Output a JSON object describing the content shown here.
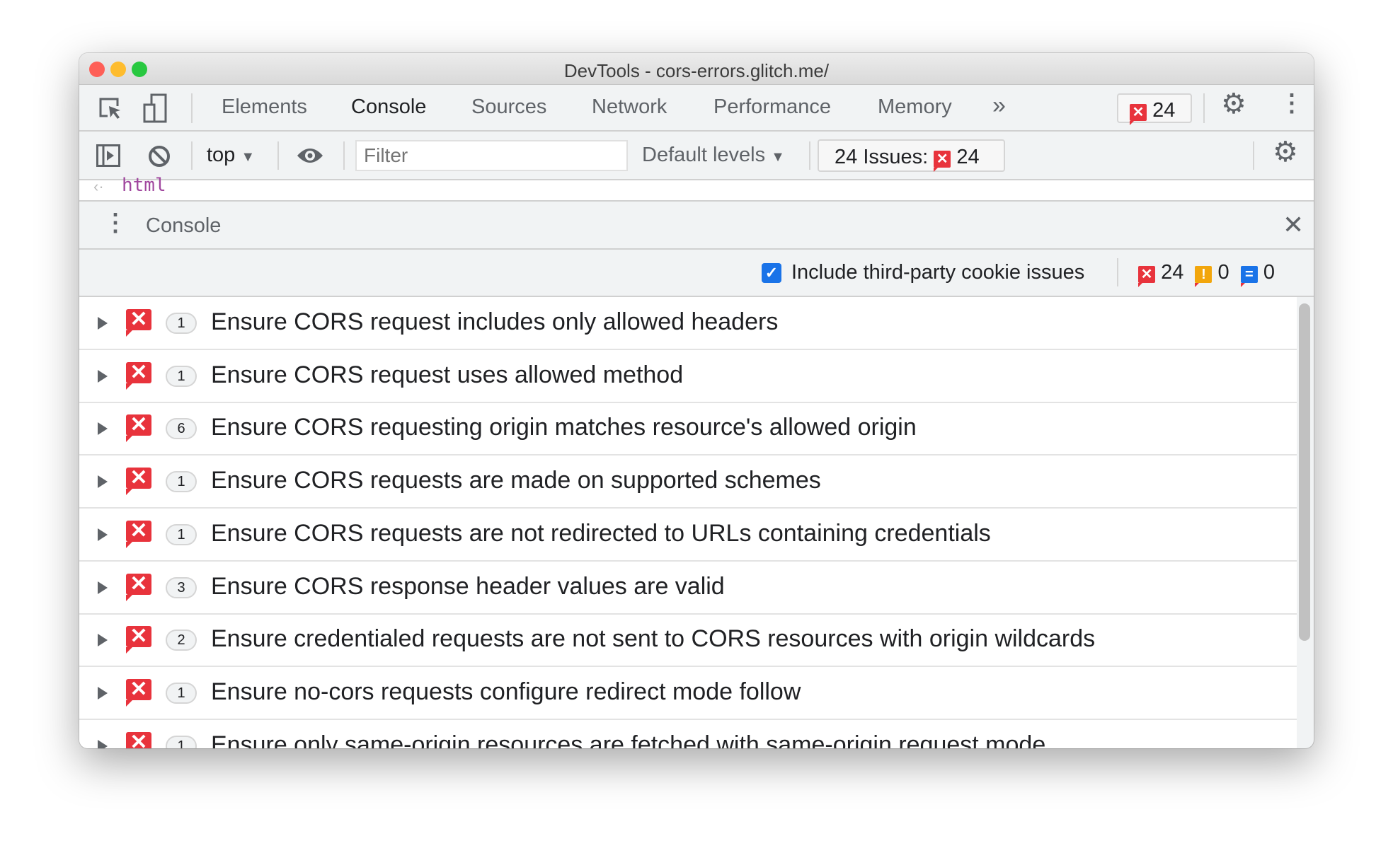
{
  "window": {
    "title": "DevTools - cors-errors.glitch.me/"
  },
  "main_toolbar": {
    "tabs": [
      "Elements",
      "Console",
      "Sources",
      "Network",
      "Performance",
      "Memory"
    ],
    "active_tab": "Console",
    "more_tabs": "»",
    "error_count": "24"
  },
  "console_toolbar": {
    "context": "top",
    "filter_placeholder": "Filter",
    "levels": "Default levels",
    "issues_label": "24 Issues:",
    "issues_count": "24"
  },
  "console_output": {
    "last_line": "html"
  },
  "drawer": {
    "title": "Console"
  },
  "issues_toolbar": {
    "checkbox_label": "Include third-party cookie issues",
    "checked": true,
    "errors": "24",
    "warnings": "0",
    "info": "0"
  },
  "colors": {
    "error": "#e8333c",
    "warning": "#f2a60c",
    "info": "#1a73e8"
  },
  "issues": [
    {
      "count": "1",
      "title": "Ensure CORS request includes only allowed headers"
    },
    {
      "count": "1",
      "title": "Ensure CORS request uses allowed method"
    },
    {
      "count": "6",
      "title": "Ensure CORS requesting origin matches resource's allowed origin"
    },
    {
      "count": "1",
      "title": "Ensure CORS requests are made on supported schemes"
    },
    {
      "count": "1",
      "title": "Ensure CORS requests are not redirected to URLs containing credentials"
    },
    {
      "count": "3",
      "title": "Ensure CORS response header values are valid"
    },
    {
      "count": "2",
      "title": "Ensure credentialed requests are not sent to CORS resources with origin wildcards"
    },
    {
      "count": "1",
      "title": "Ensure no-cors requests configure redirect mode follow"
    },
    {
      "count": "1",
      "title": "Ensure only same-origin resources are fetched with same-origin request mode"
    }
  ]
}
